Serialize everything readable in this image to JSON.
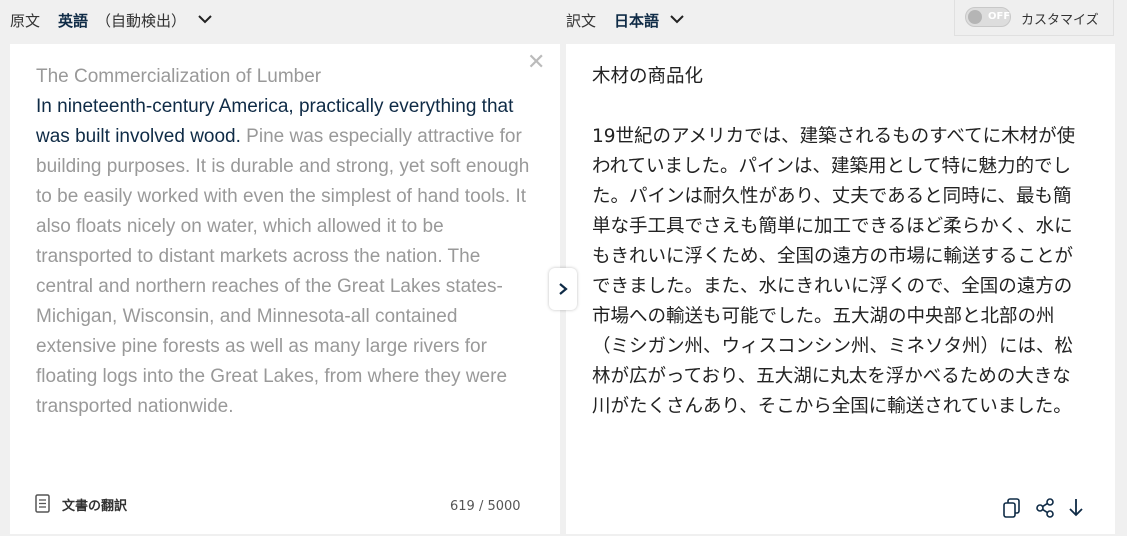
{
  "topbar": {
    "source_label": "原文",
    "source_language": "英語",
    "source_auto": "（自動検出）",
    "target_label": "訳文",
    "target_language": "日本語",
    "customize_toggle": "OFF",
    "customize_label": "カスタマイズ"
  },
  "source": {
    "title": "The Commercialization of Lumber",
    "highlighted": "In nineteenth-century America, practically everything that was built involved wood.",
    "rest": " Pine was especially attractive for building purposes. It is durable and strong, yet soft enough to be easily worked with even the simplest of hand tools. It also floats nicely on water, which allowed it to be transported to distant markets across the nation. The central and northern reaches of the Great Lakes states-Michigan, Wisconsin, and Minnesota-all contained extensive pine forests as well as many large rivers for floating logs into the Great Lakes, from where they were transported nationwide.",
    "document_button": "文書の翻訳",
    "char_count": "619 / 5000"
  },
  "target": {
    "title": "木材の商品化",
    "body": "19世紀のアメリカでは、建築されるものすべてに木材が使われていました。パインは、建築用として特に魅力的でした。パインは耐久性があり、丈夫であると同時に、最も簡単な手工具でさえも簡単に加工できるほど柔らかく、水にもきれいに浮くため、全国の遠方の市場に輸送することができました。また、水にきれいに浮くので、全国の遠方の市場への輸送も可能でした。五大湖の中央部と北部の州（ミシガン州、ウィスコンシン州、ミネソタ州）には、松林が広がっており、五大湖に丸太を浮かべるための大きな川がたくさんあり、そこから全国に輸送されていました。"
  },
  "icons": {
    "source_lang_dropdown": "chevron-down-icon",
    "target_lang_dropdown": "chevron-down-icon",
    "clear": "close-icon",
    "swap": "chevron-right-icon",
    "document": "document-icon",
    "copy": "copy-icon",
    "share": "share-icon",
    "download": "download-icon"
  },
  "colors": {
    "accent": "#0f2b46",
    "placeholder_text": "#999999"
  }
}
